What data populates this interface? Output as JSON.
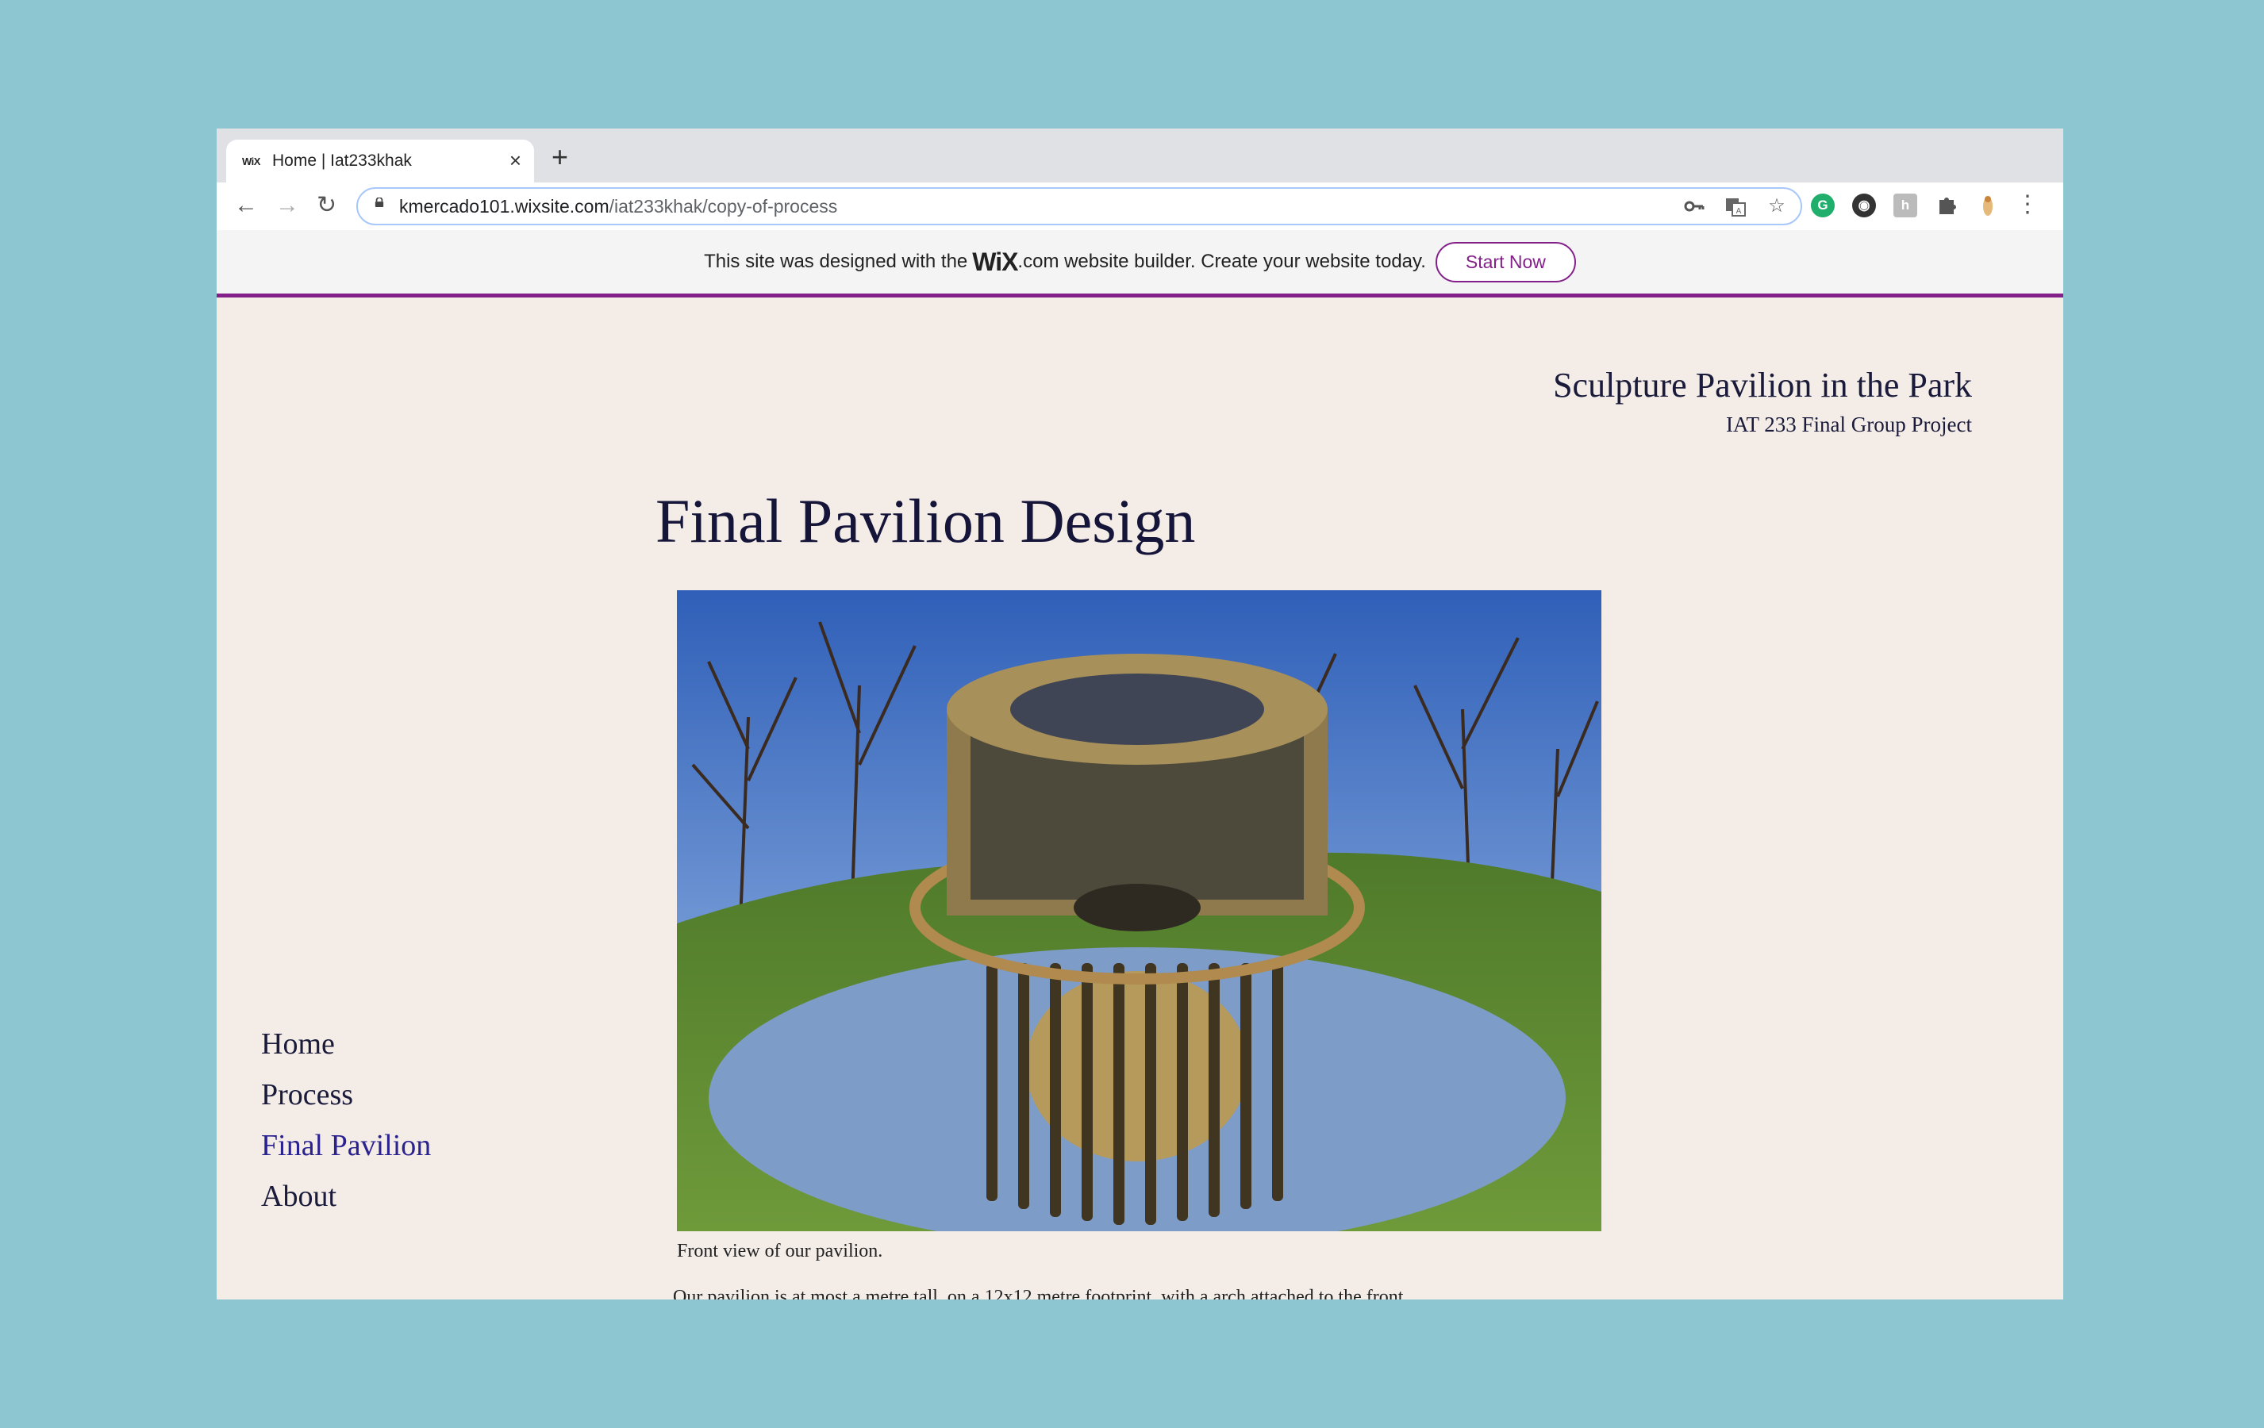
{
  "browser": {
    "tab_favicon": "WiX",
    "tab_title": "Home | Iat233khak",
    "tab_close_icon": "×",
    "new_tab_icon": "+",
    "back_icon": "←",
    "forward_icon": "→",
    "reload_icon": "↻",
    "url_host": "kmercado101.wixsite.com",
    "url_path": "/iat233khak/copy-of-process",
    "key_icon": "key-icon",
    "translate_icon": "translate-icon",
    "star_icon": "☆",
    "menu_icon": "⋮"
  },
  "wix_banner": {
    "text_before": "This site was designed with the",
    "logo": "WiX",
    "text_after": ".com website builder. Create your website today.",
    "button_label": "Start Now",
    "accent": "#84208a"
  },
  "site": {
    "title": "Sculpture Pavilion in the Park",
    "subtitle": "IAT 233 Final Group Project"
  },
  "main": {
    "heading": "Final Pavilion Design",
    "caption": "Front view of our pavilion.",
    "body_partial": "Our pavilion is at most a metre tall, on a 12x12 metre footprint, with a  arch attached to the front"
  },
  "nav": {
    "items": [
      {
        "label": "Home",
        "active": false
      },
      {
        "label": "Process",
        "active": false
      },
      {
        "label": "Final Pavilion",
        "active": true
      },
      {
        "label": "About",
        "active": false
      }
    ]
  }
}
